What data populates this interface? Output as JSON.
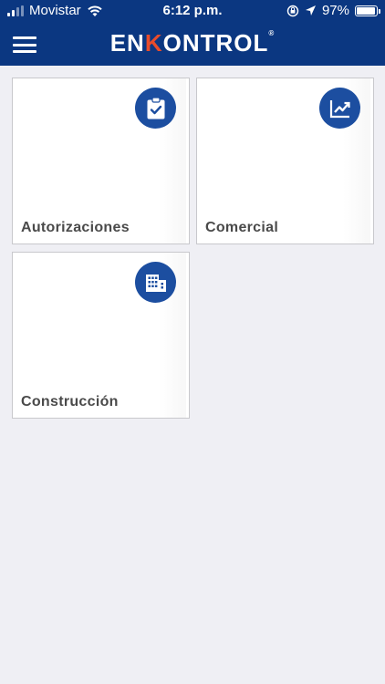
{
  "status_bar": {
    "carrier": "Movistar",
    "time": "6:12 p.m.",
    "battery": "97%",
    "battery_level": 0.97
  },
  "header": {
    "logo_part1": "EN",
    "logo_part2": "K",
    "logo_part3": "ONTROL",
    "logo_mark": "®",
    "menu_icon": "hamburger-menu-icon"
  },
  "colors": {
    "header_bg": "#0b3781",
    "badge_bg": "#1c4ea0",
    "logo_accent": "#e84c2b",
    "page_bg": "#efeff4"
  },
  "modules": [
    {
      "label": "Autorizaciones",
      "icon": "clipboard-check-icon"
    },
    {
      "label": "Comercial",
      "icon": "trending-up-chart-icon"
    },
    {
      "label": "Construcción",
      "icon": "building-icon"
    }
  ]
}
